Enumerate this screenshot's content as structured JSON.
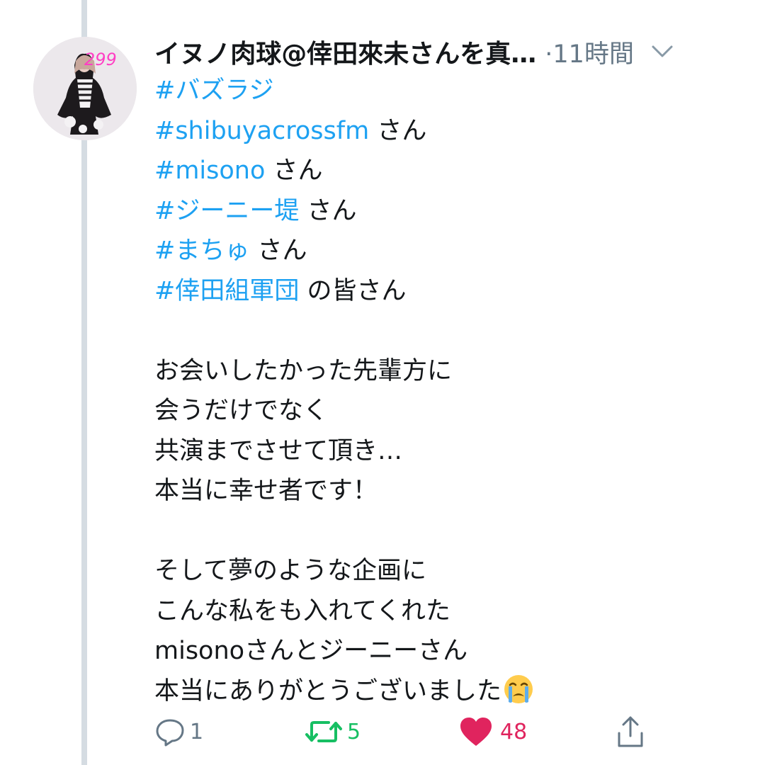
{
  "tweet": {
    "author": "イヌノ肉球@倖田來未さんを真…",
    "time": "·11時間",
    "avatar_badge": "299",
    "lines": [
      {
        "tag": "#バズラジ",
        "text": ""
      },
      {
        "tag": "#shibuyacrossfm",
        "text": " さん"
      },
      {
        "tag": "#misono",
        "text": " さん"
      },
      {
        "tag": "#ジーニー堤",
        "text": " さん"
      },
      {
        "tag": "#まちゅ",
        "text": " さん"
      },
      {
        "tag": "#倖田組軍団",
        "text": " の皆さん"
      }
    ],
    "paragraph1": [
      "お会いしたかった先輩方に",
      "会うだけでなく",
      "共演までさせて頂き…",
      "本当に幸せ者です！"
    ],
    "paragraph2": [
      "そして夢のような企画に",
      "こんな私をも入れてくれた",
      "misonoさんとジーニーさん",
      "本当にありがとうございました"
    ],
    "emoji": "loudly-crying-face"
  },
  "actions": {
    "reply_count": "1",
    "retweet_count": "5",
    "like_count": "48"
  },
  "colors": {
    "hashtag": "#1da1f2",
    "secondary": "#657786",
    "retweet": "#17bf63",
    "like": "#e0245e",
    "thread_line": "#d5dce2"
  }
}
